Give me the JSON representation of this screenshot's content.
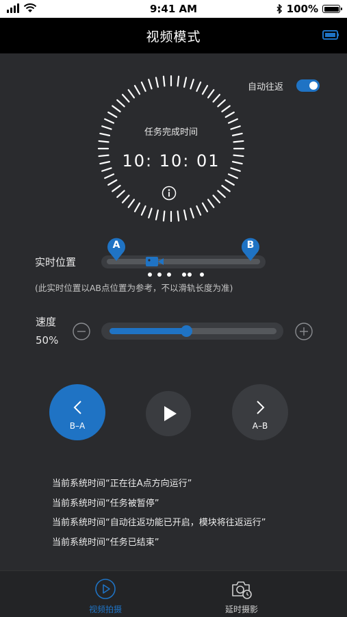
{
  "status_bar": {
    "time": "9:41 AM",
    "battery": "100%"
  },
  "header": {
    "title": "视频模式"
  },
  "auto_return": {
    "label": "自动往返",
    "enabled": true
  },
  "dial": {
    "label": "任务完成时间",
    "time": "10:  10:  01"
  },
  "rail": {
    "label": "实时位置",
    "marker_a": "A",
    "marker_b": "B",
    "note": "(此实时位置以AB点位置为参考，不以滑轨长度为准)"
  },
  "speed": {
    "label": "速度",
    "value": "50%",
    "level": 0.46
  },
  "controls": {
    "back_label": "B–A",
    "forward_label": "A–B"
  },
  "messages": [
    "当前系统时间“正在往A点方向运行”",
    "当前系统时间“任务被暂停”",
    "当前系统时间“自动往返功能已开启，模块将往返运行”",
    "当前系统时间“任务已结束”"
  ],
  "tabs": [
    {
      "label": "视频拍摄",
      "active": true
    },
    {
      "label": "延时摄影",
      "active": false
    }
  ],
  "colors": {
    "accent": "#1f73c4",
    "background": "#2a2b2e",
    "header": "#000000"
  }
}
